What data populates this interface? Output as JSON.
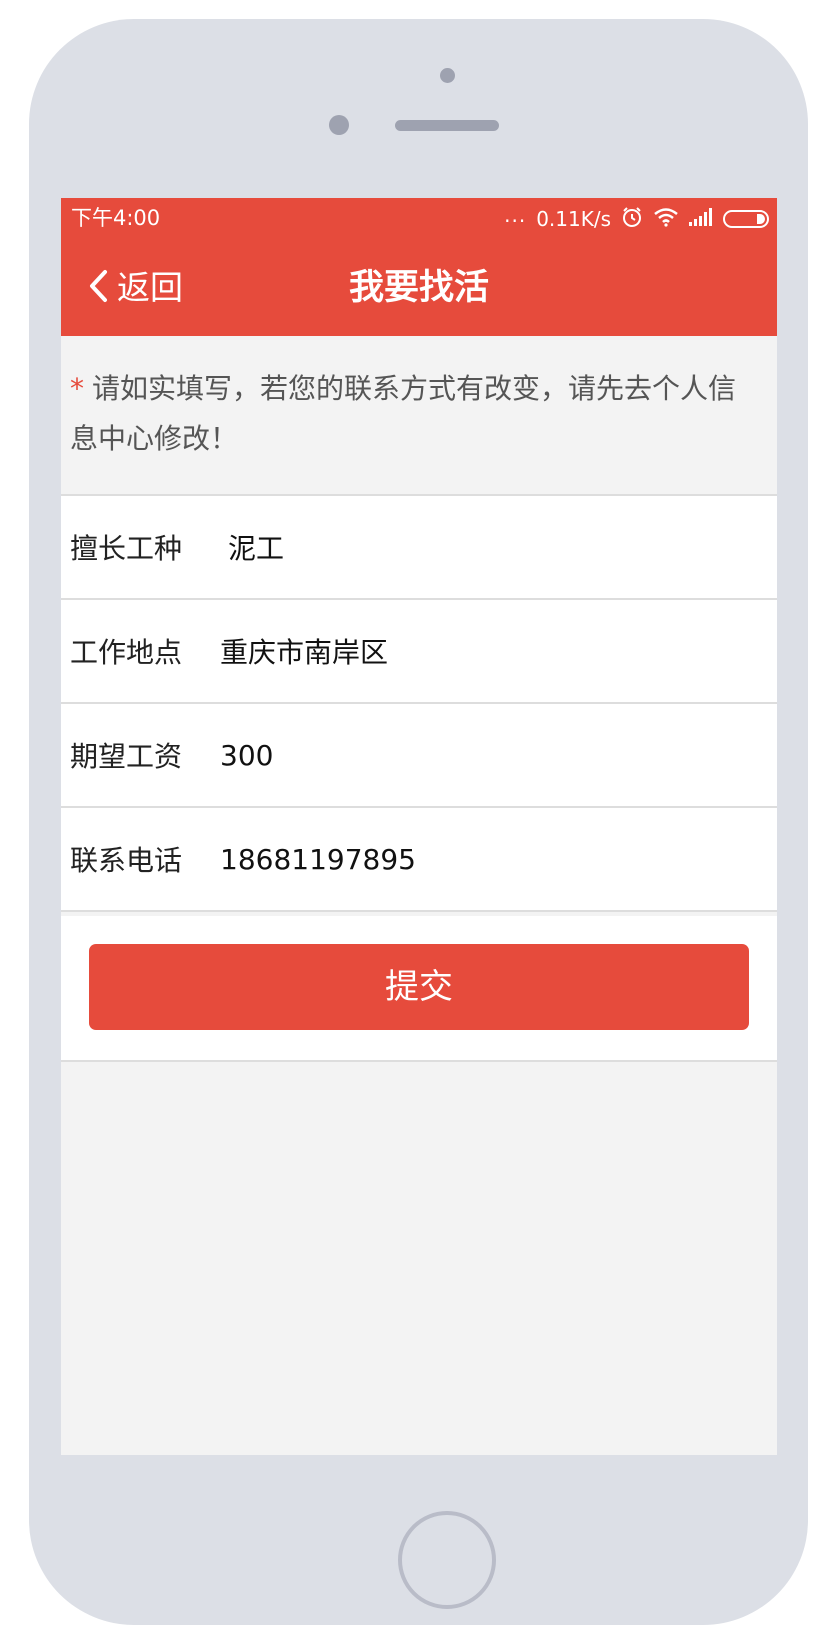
{
  "status_bar": {
    "time": "下午4:00",
    "network_speed": "0.11K/s",
    "dots": "...",
    "icons": [
      "alarm-icon",
      "wifi-icon",
      "signal-icon",
      "battery-icon"
    ]
  },
  "navbar": {
    "back_label": "返回",
    "title": "我要找活",
    "background": "#e64b3c"
  },
  "notice": {
    "star": "*",
    "text": "请如实填写，若您的联系方式有改变，请先去个人信息中心修改！"
  },
  "form": {
    "trade": {
      "label": "擅长工种",
      "value": "泥工"
    },
    "location": {
      "label": "工作地点",
      "value": "重庆市南岸区"
    },
    "salary": {
      "label": "期望工资",
      "value": "300"
    },
    "phone": {
      "label": "联系电话",
      "value": "18681197895"
    }
  },
  "submit_label": "提交",
  "colors": {
    "accent": "#e64b3c",
    "page_background": "#f3f3f3",
    "phone_frame": "#dcdfe6"
  }
}
